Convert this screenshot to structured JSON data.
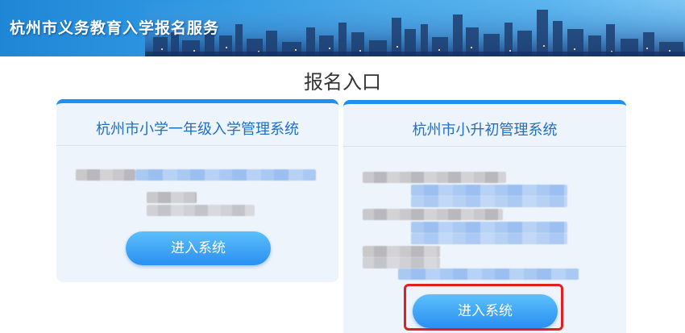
{
  "header": {
    "title": "杭州市义务教育入学报名服务"
  },
  "main": {
    "heading": "报名入口"
  },
  "cards": [
    {
      "title": "杭州市小学一年级入学管理系统",
      "button_label": "进入系统"
    },
    {
      "title": "杭州市小升初管理系统",
      "button_label": "进入系统"
    }
  ],
  "colors": {
    "accent": "#1f8ff0",
    "card_title": "#1e6fc9",
    "highlight": "#e02020"
  }
}
